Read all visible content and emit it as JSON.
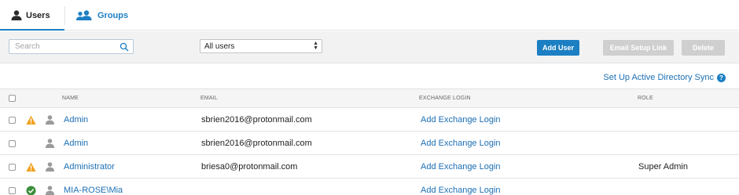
{
  "tabs": {
    "users_label": "Users",
    "groups_label": "Groups"
  },
  "toolbar": {
    "search_placeholder": "Search",
    "filter_value": "All users",
    "add_user_label": "Add User",
    "email_setup_label": "Email Setup Link",
    "delete_label": "Delete"
  },
  "sync_link": "Set Up Active Directory Sync",
  "table": {
    "headers": {
      "name": "NAME",
      "email": "EMAIL",
      "exchange": "EXCHANGE LOGIN",
      "role": "ROLE"
    },
    "rows": [
      {
        "status": "warning-icon",
        "name": "Admin",
        "email": "sbrien2016@protonmail.com",
        "exchange": "Add Exchange Login",
        "role": ""
      },
      {
        "status": "",
        "name": "Admin",
        "email": "sbrien2016@protonmail.com",
        "exchange": "Add Exchange Login",
        "role": ""
      },
      {
        "status": "warning-icon",
        "name": "Administrator",
        "email": "briesa0@protonmail.com",
        "exchange": "Add Exchange Login",
        "role": "Super Admin"
      },
      {
        "status": "check-icon",
        "name": "MIA-ROSE\\Mia",
        "email": "",
        "exchange": "Add Exchange Login",
        "role": ""
      }
    ]
  },
  "colors": {
    "accent": "#1c7fc3",
    "warning": "#f0a01e",
    "success": "#3a8f3a",
    "disabled_button": "#cfcfcf"
  }
}
